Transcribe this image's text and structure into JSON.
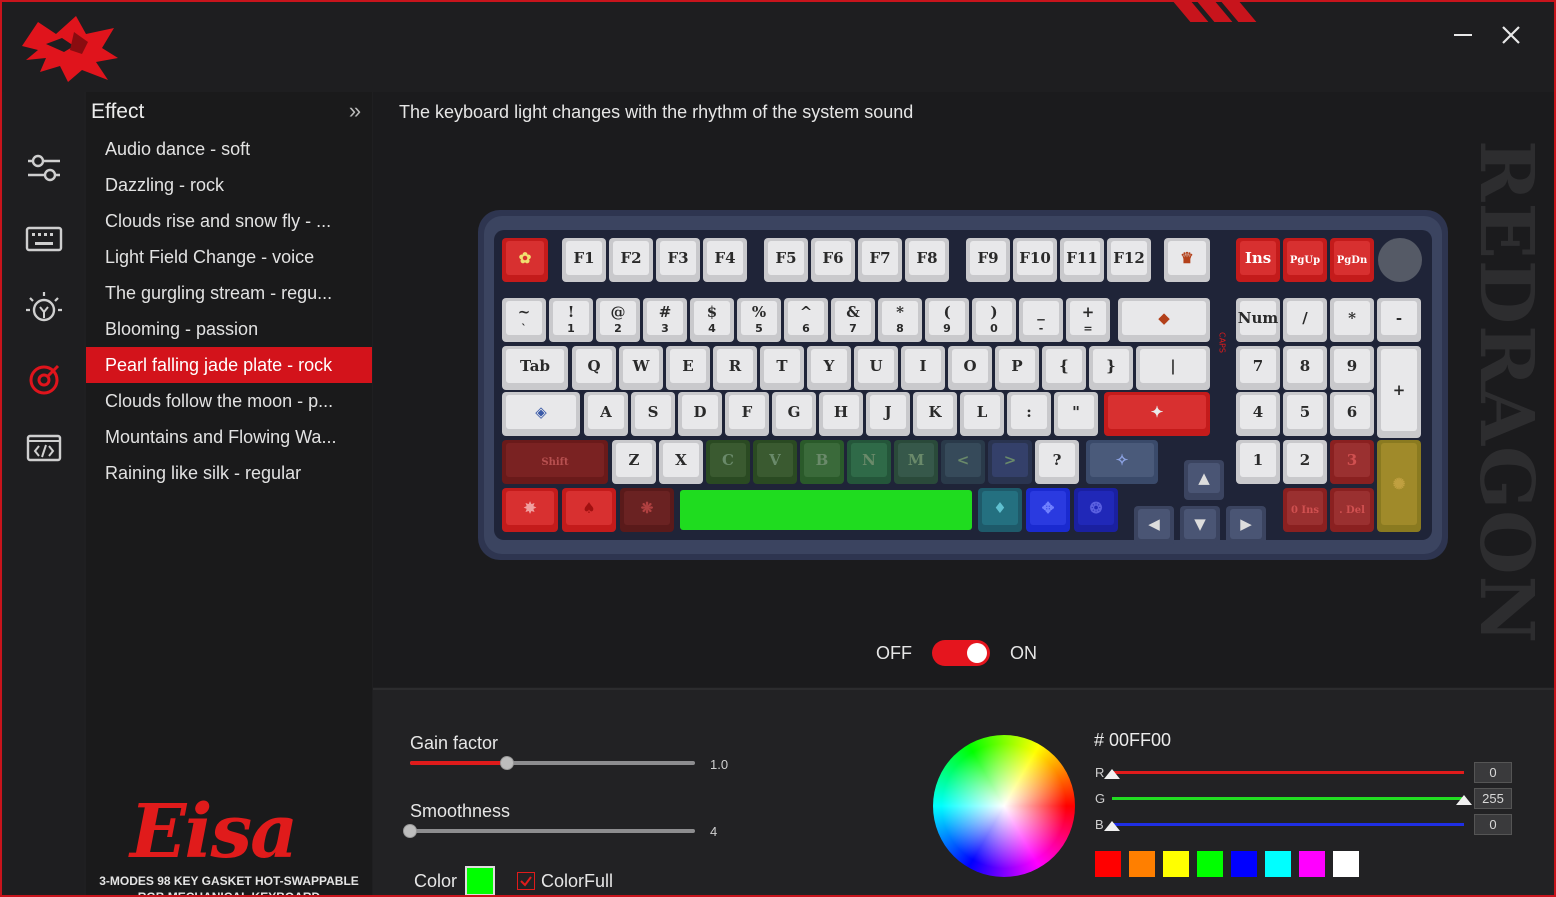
{
  "app": {
    "window": {
      "minimize_icon": "minimize-icon",
      "close_icon": "close-icon"
    },
    "sidebar_icons": [
      "sliders-icon",
      "keyboard-icon",
      "lighting-icon",
      "audio-effect-icon",
      "macro-icon"
    ]
  },
  "effect": {
    "title": "Effect",
    "collapse_glyph": "»",
    "items": [
      {
        "label": "Audio dance - soft"
      },
      {
        "label": "Dazzling - rock"
      },
      {
        "label": "Clouds rise and snow fly - ..."
      },
      {
        "label": "Light Field Change - voice"
      },
      {
        "label": "The gurgling stream - regu..."
      },
      {
        "label": "Blooming - passion"
      },
      {
        "label": "Pearl falling jade plate - rock"
      },
      {
        "label": "Clouds follow the moon - p..."
      },
      {
        "label": "Mountains and Flowing Wa..."
      },
      {
        "label": "Raining like silk - regular"
      }
    ],
    "selected_index": 6
  },
  "product": {
    "name": "Eisa",
    "line1": "3-MODES 98 KEY GASKET HOT-SWAPPABLE",
    "line2": "RGB MECHANICAL KEYBOARD"
  },
  "main": {
    "description": "The keyboard light changes with the rhythm of the system sound",
    "watermark": "REDRAGON",
    "toggle": {
      "off_label": "OFF",
      "on_label": "ON",
      "state": "on"
    }
  },
  "keyboard": {
    "fn_row": [
      "F1",
      "F2",
      "F3",
      "F4",
      "F5",
      "F6",
      "F7",
      "F8",
      "F9",
      "F10",
      "F11",
      "F12"
    ],
    "nav_keys": [
      "Ins",
      "PgUp",
      "PgDn"
    ],
    "num_row": [
      "~",
      "!",
      "@",
      "#",
      "$",
      "%",
      "^",
      "&",
      "*",
      "(",
      ")",
      "_",
      "+"
    ],
    "num_row_lower": [
      "`",
      "1",
      "2",
      "3",
      "4",
      "5",
      "6",
      "7",
      "8",
      "9",
      "0",
      "-",
      "="
    ],
    "q_row": [
      "Tab",
      "Q",
      "W",
      "E",
      "R",
      "T",
      "Y",
      "U",
      "I",
      "O",
      "P",
      "{",
      "}",
      "|"
    ],
    "a_row": [
      "A",
      "S",
      "D",
      "F",
      "G",
      "H",
      "J",
      "K",
      "L",
      ":",
      "\""
    ],
    "z_row": [
      "Shift",
      "Z",
      "X",
      "C",
      "V",
      "B",
      "N",
      "M",
      "<",
      ">",
      "?"
    ],
    "numpad_top": [
      "Num",
      "/",
      "*",
      "-"
    ],
    "numpad_row2": [
      "7",
      "8",
      "9",
      "+"
    ],
    "numpad_row3": [
      "4",
      "5",
      "6"
    ],
    "numpad_row4": [
      "1",
      "2",
      "3"
    ],
    "numpad_row5": [
      "0 Ins",
      ". Del"
    ],
    "side_leds": "CAPS"
  },
  "settings": {
    "gain": {
      "label": "Gain factor",
      "value": "1.0",
      "fraction": 0.34
    },
    "smoothness": {
      "label": "Smoothness",
      "value": "4",
      "fraction": 0.0
    },
    "color_label": "Color",
    "selected_color": "#00ff00",
    "colorfull_label": "ColorFull",
    "colorfull_checked": true
  },
  "picker": {
    "hex": "# 00FF00",
    "r": {
      "label": "R",
      "value": "0",
      "fraction": 0.0,
      "color": "#e11b1b"
    },
    "g": {
      "label": "G",
      "value": "255",
      "fraction": 1.0,
      "color": "#22dd22"
    },
    "b": {
      "label": "B",
      "value": "0",
      "fraction": 0.0,
      "color": "#1f2fe5"
    },
    "presets": [
      "#ff0000",
      "#ff7f00",
      "#ffff00",
      "#00ff00",
      "#0000ff",
      "#00ffff",
      "#ff00ff",
      "#ffffff"
    ]
  },
  "colors": {
    "accent": "#d3131b",
    "panel": "#1a1a1b",
    "keyboard_case": "#3b4460"
  }
}
